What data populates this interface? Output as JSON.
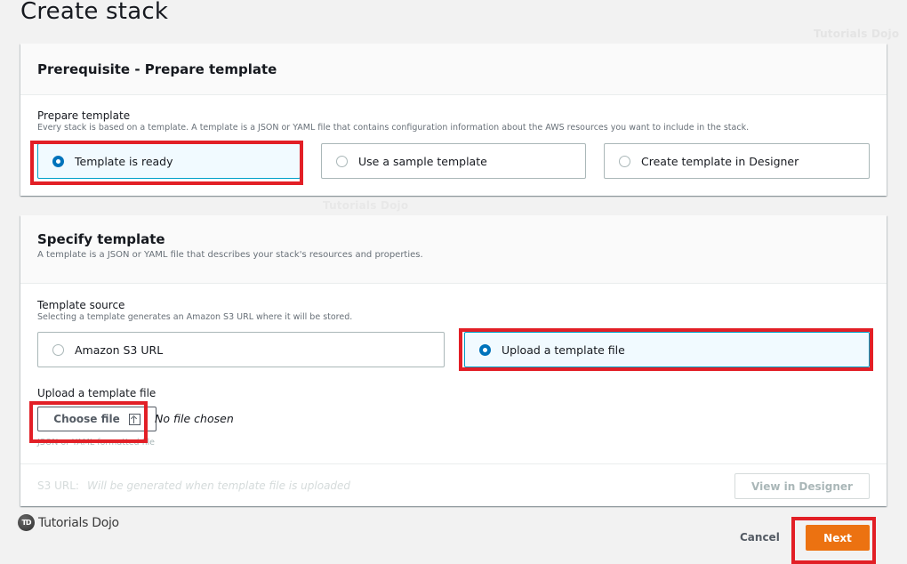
{
  "page": {
    "title": "Create stack",
    "watermark": "Tutorials Dojo"
  },
  "prerequisite": {
    "title": "Prerequisite - Prepare template",
    "field_label": "Prepare template",
    "field_description": "Every stack is based on a template. A template is a JSON or YAML file that contains configuration information about the AWS resources you want to include in the stack.",
    "options": [
      {
        "label": "Template is ready",
        "selected": true
      },
      {
        "label": "Use a sample template",
        "selected": false
      },
      {
        "label": "Create template in Designer",
        "selected": false
      }
    ]
  },
  "specify": {
    "title": "Specify template",
    "description": "A template is a JSON or YAML file that describes your stack's resources and properties.",
    "source_label": "Template source",
    "source_description": "Selecting a template generates an Amazon S3 URL where it will be stored.",
    "source_options": [
      {
        "label": "Amazon S3 URL",
        "selected": false
      },
      {
        "label": "Upload a template file",
        "selected": true
      }
    ],
    "upload_label": "Upload a template file",
    "choose_file_label": "Choose file",
    "no_file_text": "No file chosen",
    "upload_hint": "JSON or YAML formatted file",
    "s3_url_label": "S3 URL:",
    "s3_url_value": "Will be generated when template file is uploaded",
    "view_designer_label": "View in Designer"
  },
  "footer": {
    "logo_badge": "TD",
    "logo_text": "Tutorials Dojo",
    "cancel_label": "Cancel",
    "next_label": "Next"
  },
  "colors": {
    "accent": "#0073bb",
    "primary_button": "#ec7211",
    "highlight": "#e21f26",
    "selected_tile_bg": "#f1faff"
  }
}
